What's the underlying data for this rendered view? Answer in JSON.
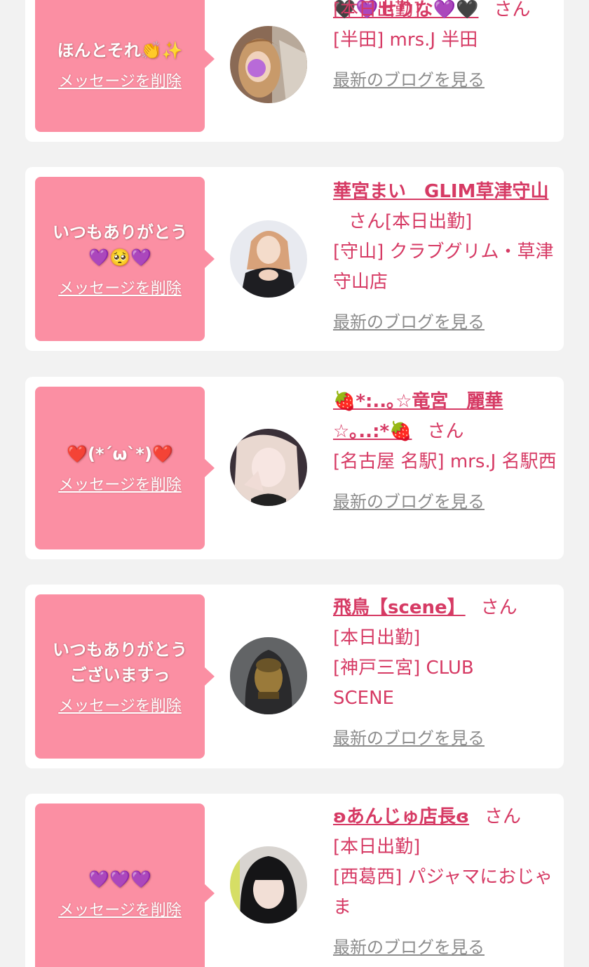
{
  "suffix_san": "さん",
  "delete_label": "メッセージを削除",
  "blog_label": "最新のブログを見る",
  "colors": {
    "background": "#f2f2f2",
    "card": "#ffffff",
    "message_box": "#fb8fa3",
    "accent_text": "#d63a64",
    "link_gray": "#8c8c8c"
  },
  "entries": [
    {
      "message": "ほんとそれ👏✨",
      "name": "🖤💜せりな💜🖤",
      "status": "[本日出勤]",
      "shop": "[半田] mrs.J 半田",
      "avatar_icon": "profile-photo"
    },
    {
      "message": "いつもありがとう💜🥺💜",
      "name": "華宮まい　GLIM草津守山",
      "status": "[本日出勤]",
      "shop": "[守山] クラブグリム・草津守山店",
      "avatar_icon": "profile-photo"
    },
    {
      "message": "❤️(*´ω`*)❤️",
      "name": "🍓*:..｡☆竜宮　麗華☆｡..:*🍓",
      "status": "",
      "shop": "[名古屋 名駅] mrs.J 名駅西",
      "avatar_icon": "profile-photo"
    },
    {
      "message": "いつもありがとうございますっ",
      "name": "飛鳥【scene】",
      "status": "[本日出勤]",
      "shop": "[神戸三宮] CLUB SCENE",
      "avatar_icon": "buddha-statue-photo"
    },
    {
      "message": "💜💜💜",
      "name": "ʚあんじゅ店長ɞ",
      "status": "[本日出勤]",
      "shop": "[西葛西] パジャマにおじゃま",
      "avatar_icon": "profile-photo"
    }
  ]
}
